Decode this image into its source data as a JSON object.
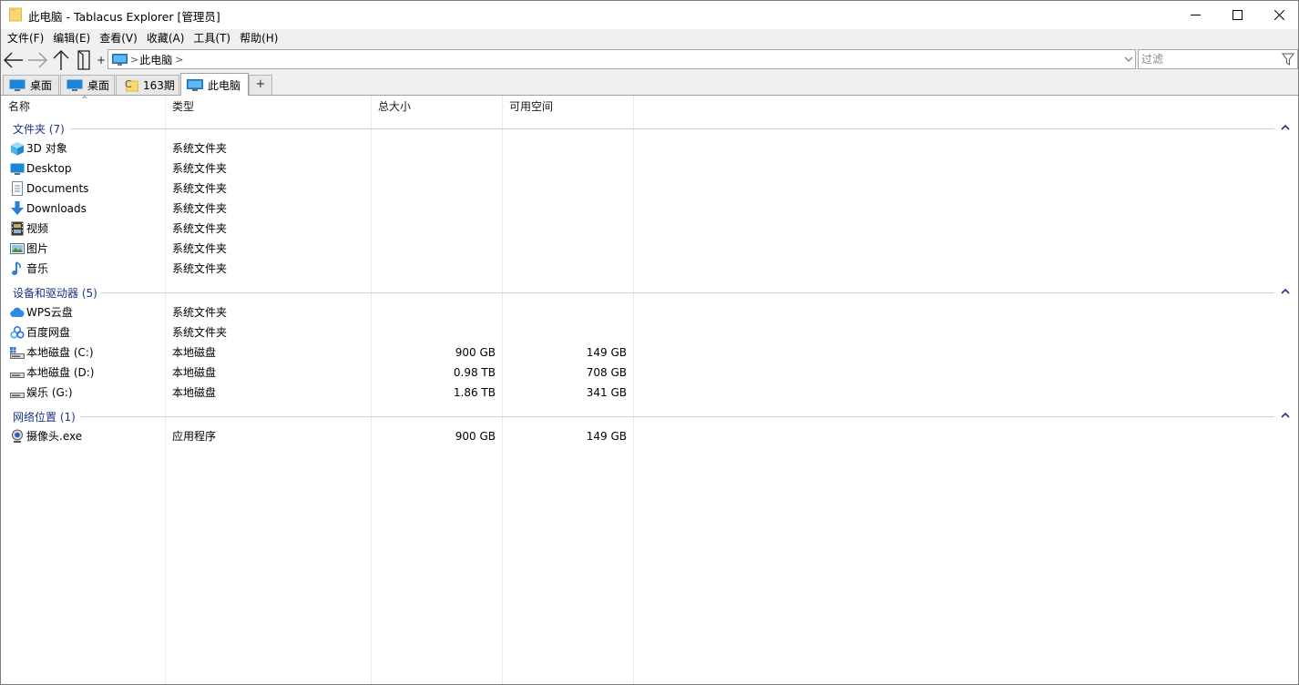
{
  "window": {
    "title": "此电脑 - Tablacus Explorer [管理员]"
  },
  "menu": [
    "文件(F)",
    "编辑(E)",
    "查看(V)",
    "收藏(A)",
    "工具(T)",
    "帮助(H)"
  ],
  "toolbar": {
    "plus_label": "+",
    "address_sep": ">",
    "address_path": "此电脑",
    "address_trail": ">",
    "filter_placeholder": "过滤"
  },
  "tabs": [
    {
      "label": "桌面",
      "icon": "desktop-icon"
    },
    {
      "label": "桌面",
      "icon": "desktop-icon"
    },
    {
      "label": "163期",
      "icon": "folder-icon",
      "prefix": "C"
    },
    {
      "label": "此电脑",
      "icon": "computer-icon",
      "active": true
    }
  ],
  "tab_add_label": "+",
  "columns": {
    "name": "名称",
    "type": "类型",
    "size": "总大小",
    "free": "可用空间"
  },
  "sort_indicator": "^",
  "groups": [
    {
      "label": "文件夹 (7)",
      "items": [
        {
          "name": "3D 对象",
          "type": "系统文件夹",
          "size": "",
          "free": "",
          "icon": "3d-objects-icon"
        },
        {
          "name": "Desktop",
          "type": "系统文件夹",
          "size": "",
          "free": "",
          "icon": "desktop-icon"
        },
        {
          "name": "Documents",
          "type": "系统文件夹",
          "size": "",
          "free": "",
          "icon": "documents-icon"
        },
        {
          "name": "Downloads",
          "type": "系统文件夹",
          "size": "",
          "free": "",
          "icon": "downloads-icon"
        },
        {
          "name": "视频",
          "type": "系统文件夹",
          "size": "",
          "free": "",
          "icon": "videos-icon"
        },
        {
          "name": "图片",
          "type": "系统文件夹",
          "size": "",
          "free": "",
          "icon": "pictures-icon"
        },
        {
          "name": "音乐",
          "type": "系统文件夹",
          "size": "",
          "free": "",
          "icon": "music-icon"
        }
      ]
    },
    {
      "label": "设备和驱动器 (5)",
      "items": [
        {
          "name": "WPS云盘",
          "type": "系统文件夹",
          "size": "",
          "free": "",
          "icon": "wps-cloud-icon"
        },
        {
          "name": "百度网盘",
          "type": "系统文件夹",
          "size": "",
          "free": "",
          "icon": "baidu-netdisk-icon"
        },
        {
          "name": "本地磁盘 (C:)",
          "type": "本地磁盘",
          "size": "900 GB",
          "free": "149 GB",
          "icon": "system-drive-icon"
        },
        {
          "name": "本地磁盘 (D:)",
          "type": "本地磁盘",
          "size": "0.98 TB",
          "free": "708 GB",
          "icon": "drive-icon"
        },
        {
          "name": "娱乐 (G:)",
          "type": "本地磁盘",
          "size": "1.86 TB",
          "free": "341 GB",
          "icon": "drive-icon"
        }
      ]
    },
    {
      "label": "网络位置 (1)",
      "items": [
        {
          "name": "摄像头.exe",
          "type": "应用程序",
          "size": "900 GB",
          "free": "149 GB",
          "icon": "webcam-icon"
        }
      ]
    }
  ],
  "colors": {
    "group_text": "#1e3287",
    "group_line": "#c5d3e6",
    "chrome_bg": "#f0f0f0"
  }
}
